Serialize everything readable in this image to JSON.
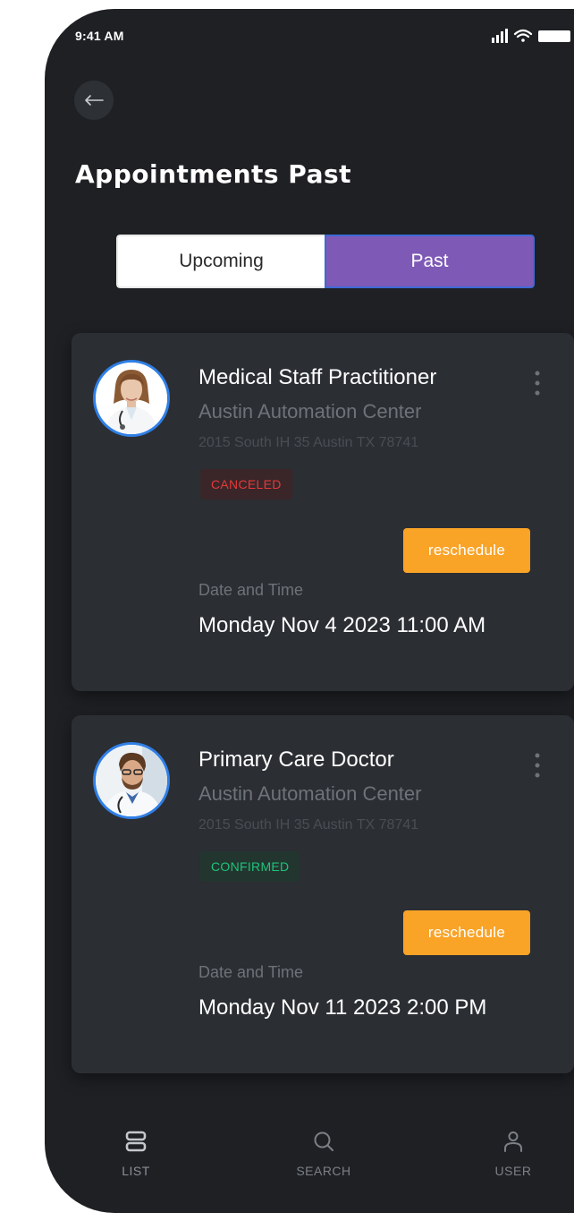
{
  "status_bar": {
    "time": "9:41 AM"
  },
  "header": {
    "back_icon": "arrow-left-icon",
    "title": "Appointments Past"
  },
  "segment": {
    "options": [
      "Upcoming",
      "Past"
    ],
    "selected": "Past",
    "selected_color": "#7e59b6"
  },
  "appointments": [
    {
      "title": "Medical Staff Practitioner",
      "location": "Austin Automation Center",
      "address": "2015 South IH 35 Austin TX 78741",
      "status": "CANCELED",
      "status_color": "#e23a3a",
      "action_label": "reschedule",
      "datetime_label": "Date and Time",
      "datetime": "Monday Nov 4 2023 11:00 AM"
    },
    {
      "title": "Primary Care Doctor",
      "location": "Austin Automation Center",
      "address": "2015 South IH 35 Austin TX 78741",
      "status": "CONFIRMED",
      "status_color": "#1fc27a",
      "action_label": "reschedule",
      "datetime_label": "Date and Time",
      "datetime": "Monday Nov 11 2023 2:00 PM"
    }
  ],
  "tabbar": {
    "items": [
      {
        "label": "LIST",
        "icon": "list-icon"
      },
      {
        "label": "SEARCH",
        "icon": "search-icon"
      },
      {
        "label": "USER",
        "icon": "user-icon"
      }
    ]
  },
  "colors": {
    "background": "#1e2024",
    "card": "#2b2e33",
    "accent": "#f9a327"
  }
}
